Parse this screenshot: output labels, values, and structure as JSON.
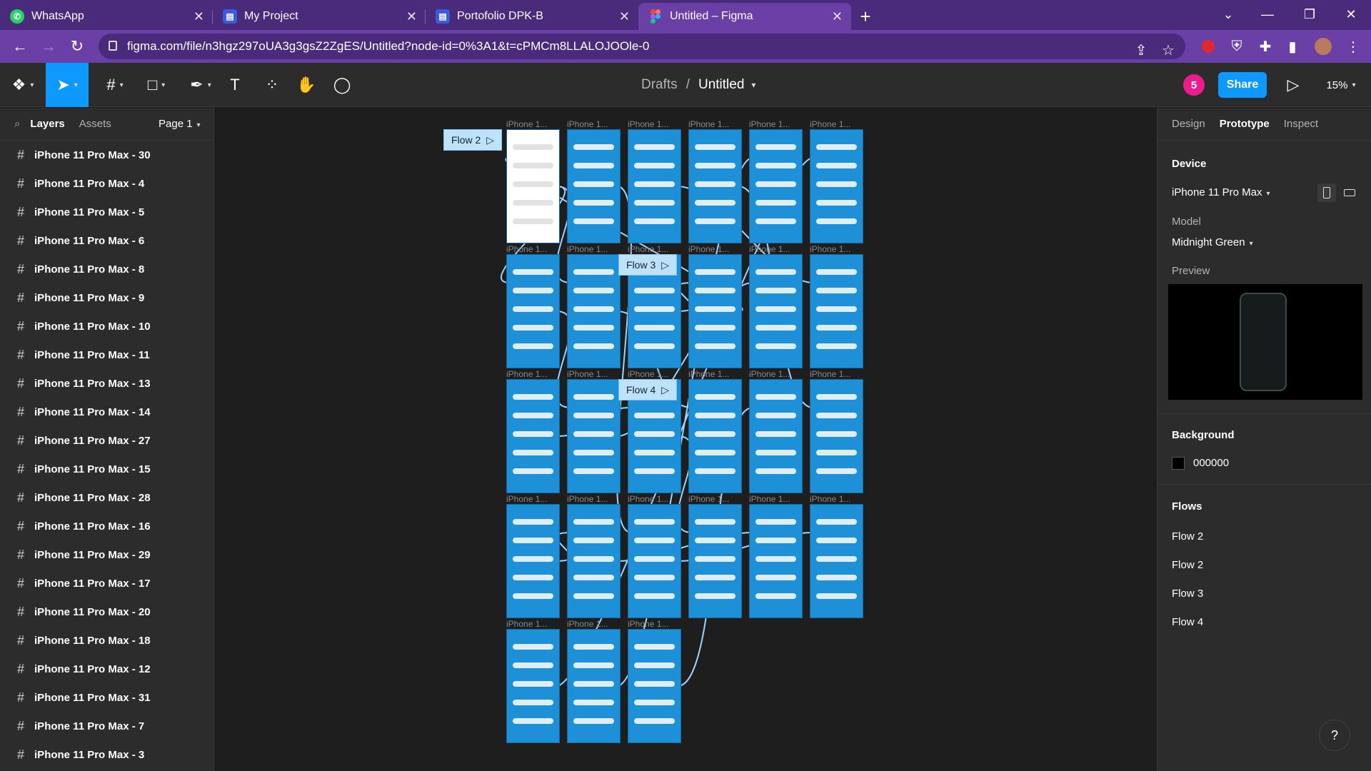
{
  "browser": {
    "tabs": [
      {
        "label": "WhatsApp",
        "icon": "whatsapp-icon"
      },
      {
        "label": "My Project",
        "icon": "docs-icon"
      },
      {
        "label": "Portofolio DPK-B",
        "icon": "docs-icon"
      },
      {
        "label": "Untitled – Figma",
        "icon": "figma-icon"
      }
    ],
    "url": "figma.com/file/n3hgz297oUA3g3gsZ2ZgES/Untitled?node-id=0%3A1&t=cPMCm8LLALOJOOle-0"
  },
  "toolbar": {
    "breadcrumb_parent": "Drafts",
    "breadcrumb_sep": "/",
    "file_name": "Untitled",
    "avatar_count": "5",
    "share_label": "Share",
    "zoom": "15%"
  },
  "left_panel": {
    "tabs": [
      "Layers",
      "Assets"
    ],
    "page": "Page 1",
    "layers": [
      "iPhone 11 Pro Max - 30",
      "iPhone 11 Pro Max - 4",
      "iPhone 11 Pro Max - 5",
      "iPhone 11 Pro Max - 6",
      "iPhone 11 Pro Max - 8",
      "iPhone 11 Pro Max - 9",
      "iPhone 11 Pro Max - 10",
      "iPhone 11 Pro Max - 11",
      "iPhone 11 Pro Max - 13",
      "iPhone 11 Pro Max - 14",
      "iPhone 11 Pro Max - 27",
      "iPhone 11 Pro Max - 15",
      "iPhone 11 Pro Max - 28",
      "iPhone 11 Pro Max - 16",
      "iPhone 11 Pro Max - 29",
      "iPhone 11 Pro Max - 17",
      "iPhone 11 Pro Max - 20",
      "iPhone 11 Pro Max - 18",
      "iPhone 11 Pro Max - 12",
      "iPhone 11 Pro Max - 31",
      "iPhone 11 Pro Max - 7",
      "iPhone 11 Pro Max - 3"
    ]
  },
  "canvas": {
    "frame_label": "iPhone 1...",
    "flows": [
      "Flow 2",
      "Flow 3",
      "Flow 4"
    ]
  },
  "right_panel": {
    "tabs": [
      "Design",
      "Prototype",
      "Inspect"
    ],
    "device_heading": "Device",
    "device": "iPhone 11 Pro Max",
    "model_heading": "Model",
    "model": "Midnight Green",
    "preview_heading": "Preview",
    "background_heading": "Background",
    "background_color": "000000",
    "flows_heading": "Flows",
    "flows": [
      "Flow 2",
      "Flow 2",
      "Flow 3",
      "Flow 4"
    ]
  },
  "help": "?",
  "colors": {
    "accent": "#0d99ff",
    "browser": "#6a3fa6",
    "frame": "#1e90d8"
  }
}
